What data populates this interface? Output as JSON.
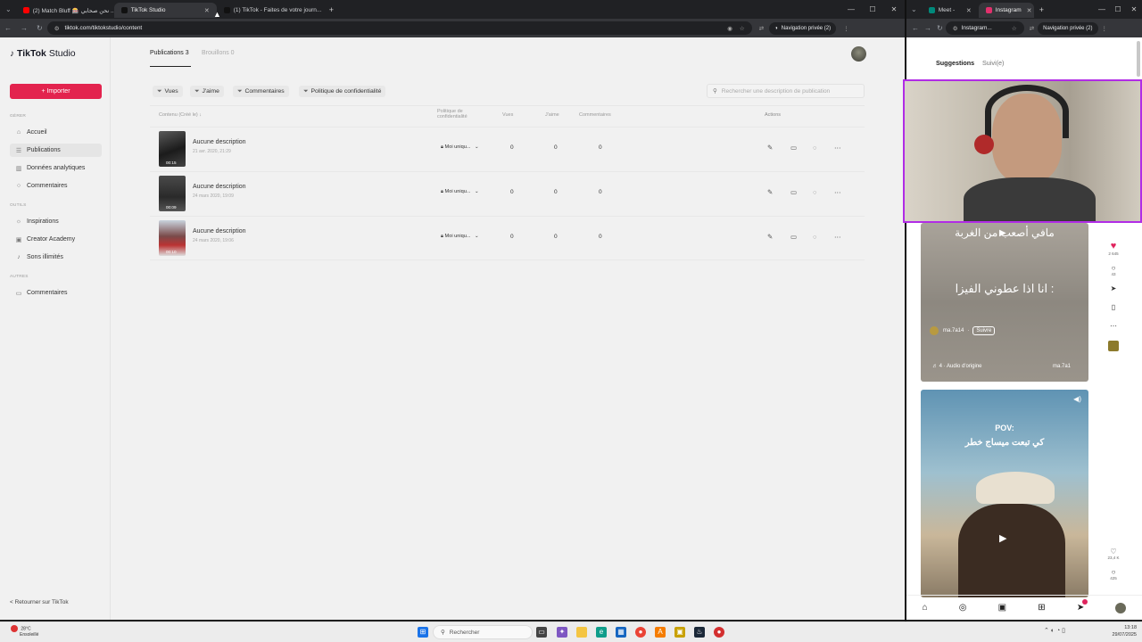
{
  "browser_left": {
    "tabs": [
      {
        "label": "(2) Match Bluff 🎰 نحن صحابي ...",
        "fav": "#ff0000"
      },
      {
        "label": "TikTok Studio",
        "fav": "#111111",
        "active": true
      },
      {
        "label": "(1) TikTok - Faites de votre journ...",
        "fav": "#111111"
      }
    ],
    "new_tab": "+",
    "url": "tiktok.com/tiktokstudio/content",
    "private_label": "Navigation privée (2)"
  },
  "browser_right": {
    "tabs": [
      {
        "label": "Meet -",
        "fav": "#00897b"
      },
      {
        "label": "Instagram",
        "fav": "#e1306c",
        "active": true
      }
    ],
    "new_tab": "+",
    "url": "Instagram...",
    "private_label": "Navigation privée (2)"
  },
  "tiktok": {
    "logo_main": "TikTok",
    "logo_sub": "Studio",
    "import_label": "+ Importer",
    "sections": {
      "gerer": "GÉRER",
      "outils": "OUTILS",
      "autres": "AUTRES"
    },
    "nav": [
      {
        "label": "Accueil",
        "icon": "home-icon"
      },
      {
        "label": "Publications",
        "icon": "list-icon"
      },
      {
        "label": "Données analytiques",
        "icon": "chart-icon"
      },
      {
        "label": "Commentaires",
        "icon": "comment-icon"
      },
      {
        "label": "Inspirations",
        "icon": "bulb-icon"
      },
      {
        "label": "Creator Academy",
        "icon": "grad-cap-icon"
      },
      {
        "label": "Sons illimités",
        "icon": "music-note-icon"
      },
      {
        "label": "Commentaires",
        "icon": "comment-icon"
      }
    ],
    "back_label": "< Retourner sur TikTok",
    "top_tabs": {
      "publications": "Publications 3",
      "brouillons": "Brouillons 0"
    },
    "filters": [
      "Vues",
      "J'aime",
      "Commentaires",
      "Politique de confidentialité"
    ],
    "search_placeholder": "Rechercher une description de publication",
    "columns": {
      "content": "Contenu (Créé le) ↓",
      "privacy_1": "Politique de",
      "privacy_2": "confidentialité",
      "views": "Vues",
      "likes": "J'aime",
      "comments": "Commentaires",
      "actions": "Actions"
    },
    "rows": [
      {
        "description": "Aucune description",
        "date": "21 avr. 2020, 21:29",
        "duration": "00:15",
        "privacy": "Moi uniqu...",
        "views": "0",
        "likes": "0",
        "comments": "0"
      },
      {
        "description": "Aucune description",
        "date": "24 mars 2020, 19:09",
        "duration": "00:09",
        "privacy": "Moi uniqu...",
        "views": "0",
        "likes": "0",
        "comments": "0"
      },
      {
        "description": "Aucune description",
        "date": "24 mars 2020, 19:06",
        "duration": "00:10",
        "privacy": "Moi uniqu...",
        "views": "0",
        "likes": "0",
        "comments": "0"
      }
    ]
  },
  "instagram": {
    "tabs": {
      "suggestions": "Suggestions",
      "suivi": "Suivi(e)"
    },
    "post1": {
      "caption_top": "مافي أصعب من الغربة",
      "caption_mid": "انا اذا عطوني الفيزا :",
      "username": "ma.7a14",
      "follow": "Suivre",
      "audio": "♬ 4 · Audio d'origine",
      "audio_user": "ma.7a1"
    },
    "rail1": {
      "likes": "2 645",
      "comments": "43"
    },
    "post2": {
      "caption_pov": "POV:",
      "caption_ar": "كي تبعت ميساج خطر"
    },
    "rail2": {
      "likes": "23,4 K",
      "comments": "425"
    }
  },
  "taskbar": {
    "weather_temp": "28°C",
    "weather_text": "Ensoleillé",
    "search_label": "Rechercher",
    "time": "13:18",
    "date": "29/07/2025"
  }
}
